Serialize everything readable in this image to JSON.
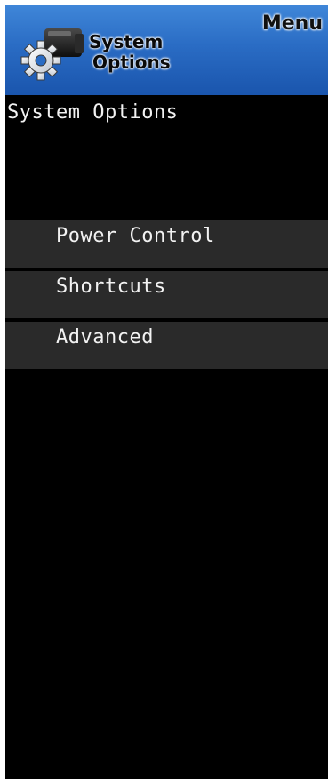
{
  "header": {
    "title_line1": "System",
    "title_line2": "Options",
    "menu_label": "Menu",
    "icon": "gear-camera-icon",
    "colors": {
      "header_top": "#3f86d8",
      "header_bottom": "#1a55ad"
    }
  },
  "page": {
    "title": "System Options"
  },
  "menu": {
    "items": [
      {
        "label": "Power Control"
      },
      {
        "label": "Shortcuts"
      },
      {
        "label": "Advanced"
      }
    ]
  },
  "colors": {
    "background": "#000000",
    "item_background": "#2a2a2a",
    "text": "#f2f2f2"
  }
}
